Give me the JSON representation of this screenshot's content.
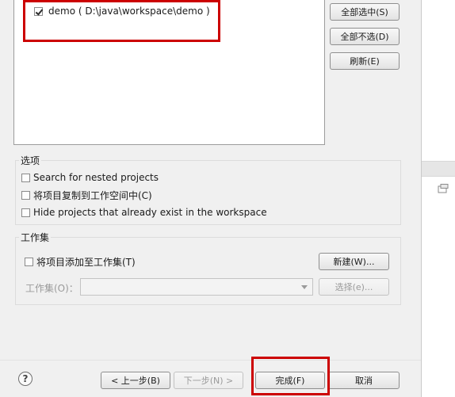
{
  "projects": {
    "items": [
      {
        "label": "demo ( D:\\java\\workspace\\demo )",
        "checked": true
      }
    ]
  },
  "side_buttons": {
    "select_all": "全部选中(S)",
    "deselect_all": "全部不选(D)",
    "refresh": "刷新(E)"
  },
  "options": {
    "title": "选项",
    "nested": "Search for nested projects",
    "copy": "将项目复制到工作空间中(C)",
    "hide_existing": "Hide projects that already exist in the workspace"
  },
  "working_sets": {
    "title": "工作集",
    "add_to_set": "将项目添加至工作集(T)",
    "new_button": "新建(W)...",
    "set_label": "工作集(O)：",
    "select_button": "选择(e)..."
  },
  "footer": {
    "back": "< 上一步(B)",
    "next": "下一步(N) >",
    "finish": "完成(F)",
    "cancel": "取消"
  },
  "colors": {
    "dialog_bg": "#f0f0f0",
    "highlight_red": "#cc0000"
  }
}
